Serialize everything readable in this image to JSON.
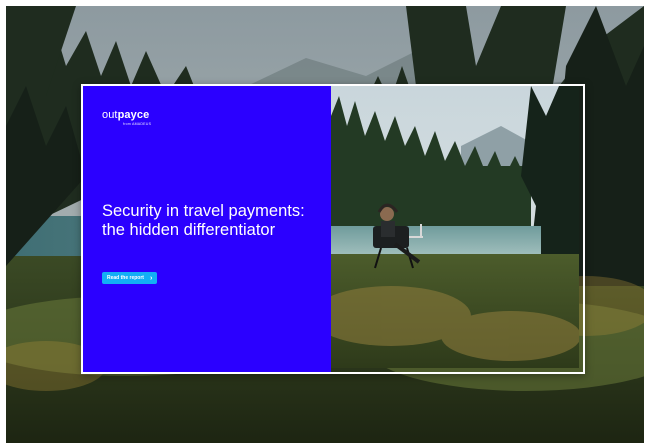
{
  "brand": {
    "logo_prefix": "out",
    "logo_main": "payce",
    "logo_suffix": "e",
    "logo_sub": "from AMADEUS",
    "accent": "#2b00ff",
    "cta_color": "#13aef5"
  },
  "hero": {
    "headline": "Security in travel payments: the hidden differentiator",
    "cta_label": "Read the report",
    "cta_icon": "chevron-right-icon"
  }
}
